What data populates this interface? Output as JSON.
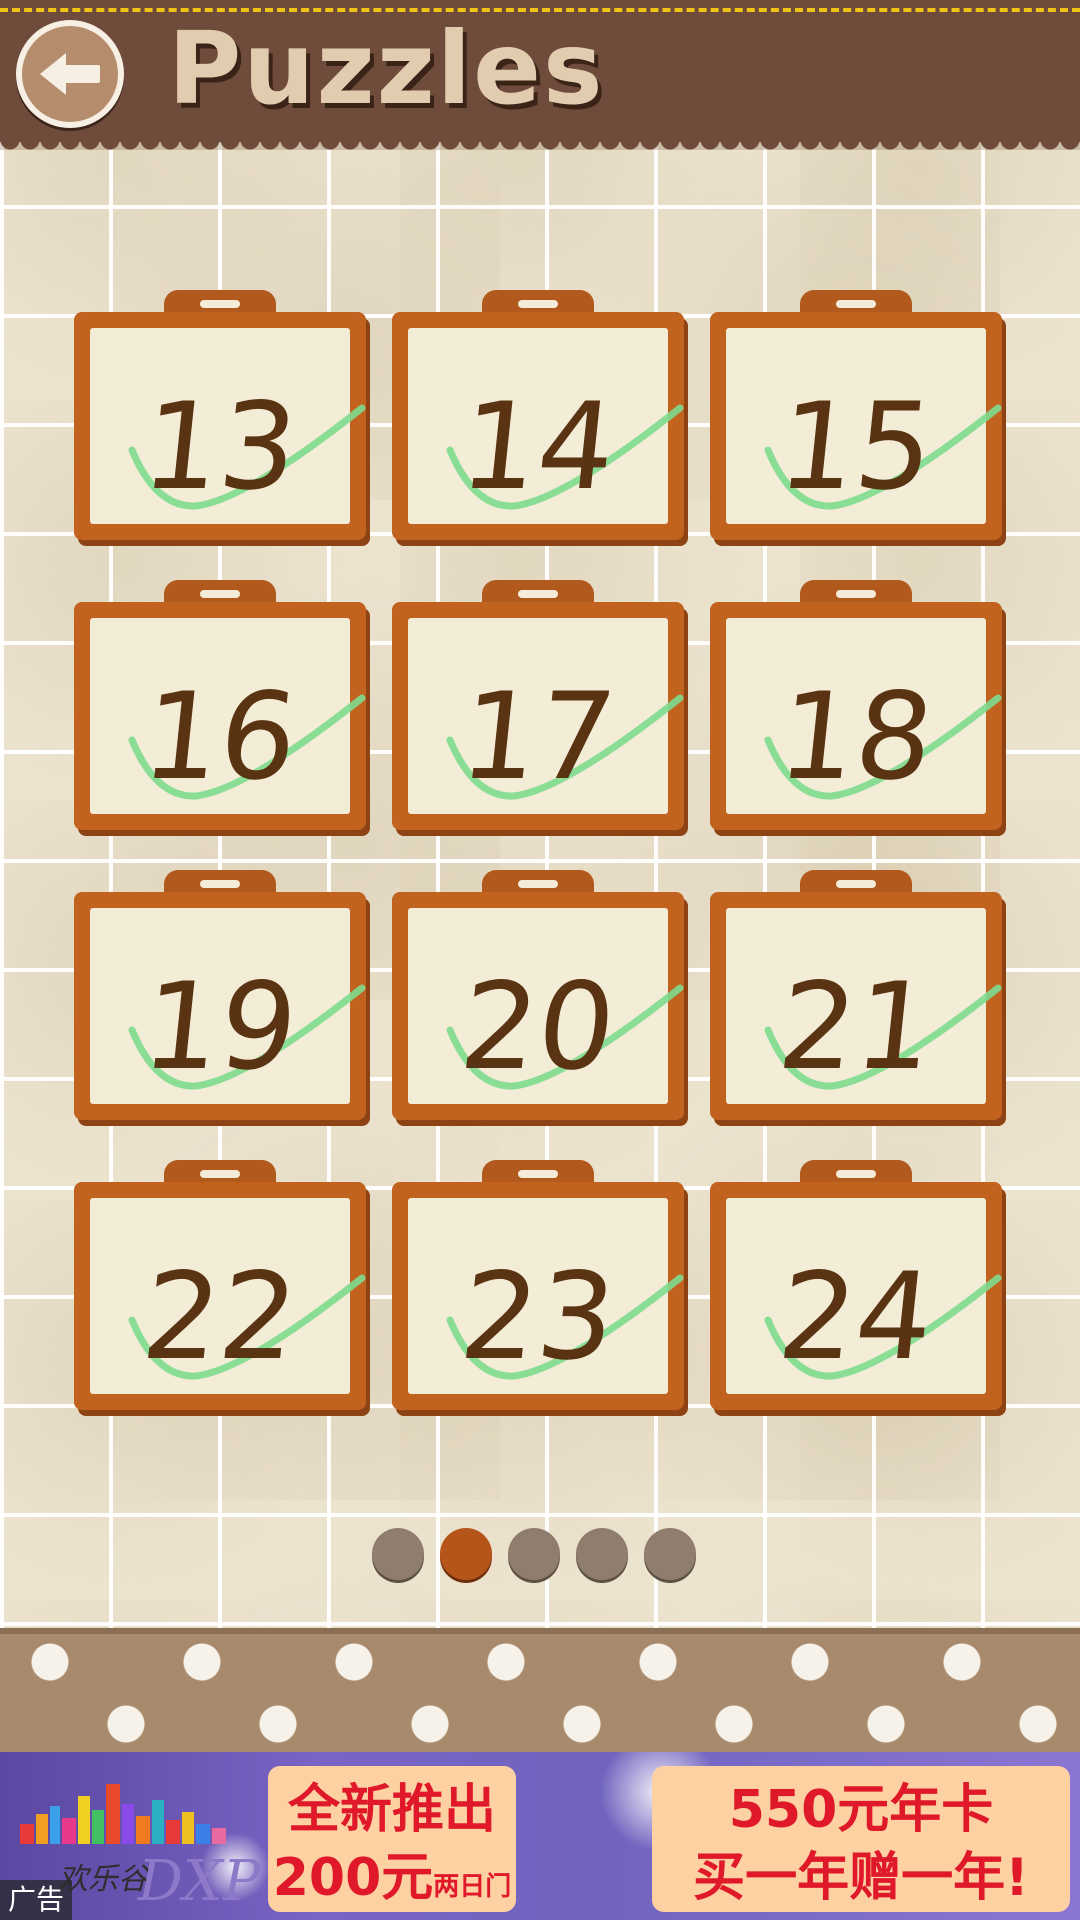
{
  "header": {
    "title": "Puzzles",
    "back_icon": "arrow-left-icon"
  },
  "levels": [
    {
      "label": "13",
      "completed": true
    },
    {
      "label": "14",
      "completed": true
    },
    {
      "label": "15",
      "completed": true
    },
    {
      "label": "16",
      "completed": true
    },
    {
      "label": "17",
      "completed": true
    },
    {
      "label": "18",
      "completed": true
    },
    {
      "label": "19",
      "completed": true
    },
    {
      "label": "20",
      "completed": true
    },
    {
      "label": "21",
      "completed": true
    },
    {
      "label": "22",
      "completed": true
    },
    {
      "label": "23",
      "completed": true
    },
    {
      "label": "24",
      "completed": true
    }
  ],
  "pager": {
    "page_count": 5,
    "current_page": 2
  },
  "ad": {
    "label": "广告",
    "logo_text": "欢乐谷",
    "logo_brand": "DXP",
    "promo1_line1": "全新推出",
    "promo1_line2": "200元",
    "promo1_line2_small": "两日门票",
    "promo2_line1": "550元年卡",
    "promo2_line2": "买一年赠一年!"
  },
  "colors": {
    "header_bg": "#6e4b3a",
    "header_stitch": "#f0c414",
    "card_frame": "#c2621f",
    "card_paper": "#f3ecd7",
    "number_ink": "#5a3412",
    "check_green": "#7ddc8e",
    "dot_active": "#b65519",
    "dot_inactive": "#8f7e6e",
    "ad_text": "#e0192a"
  }
}
